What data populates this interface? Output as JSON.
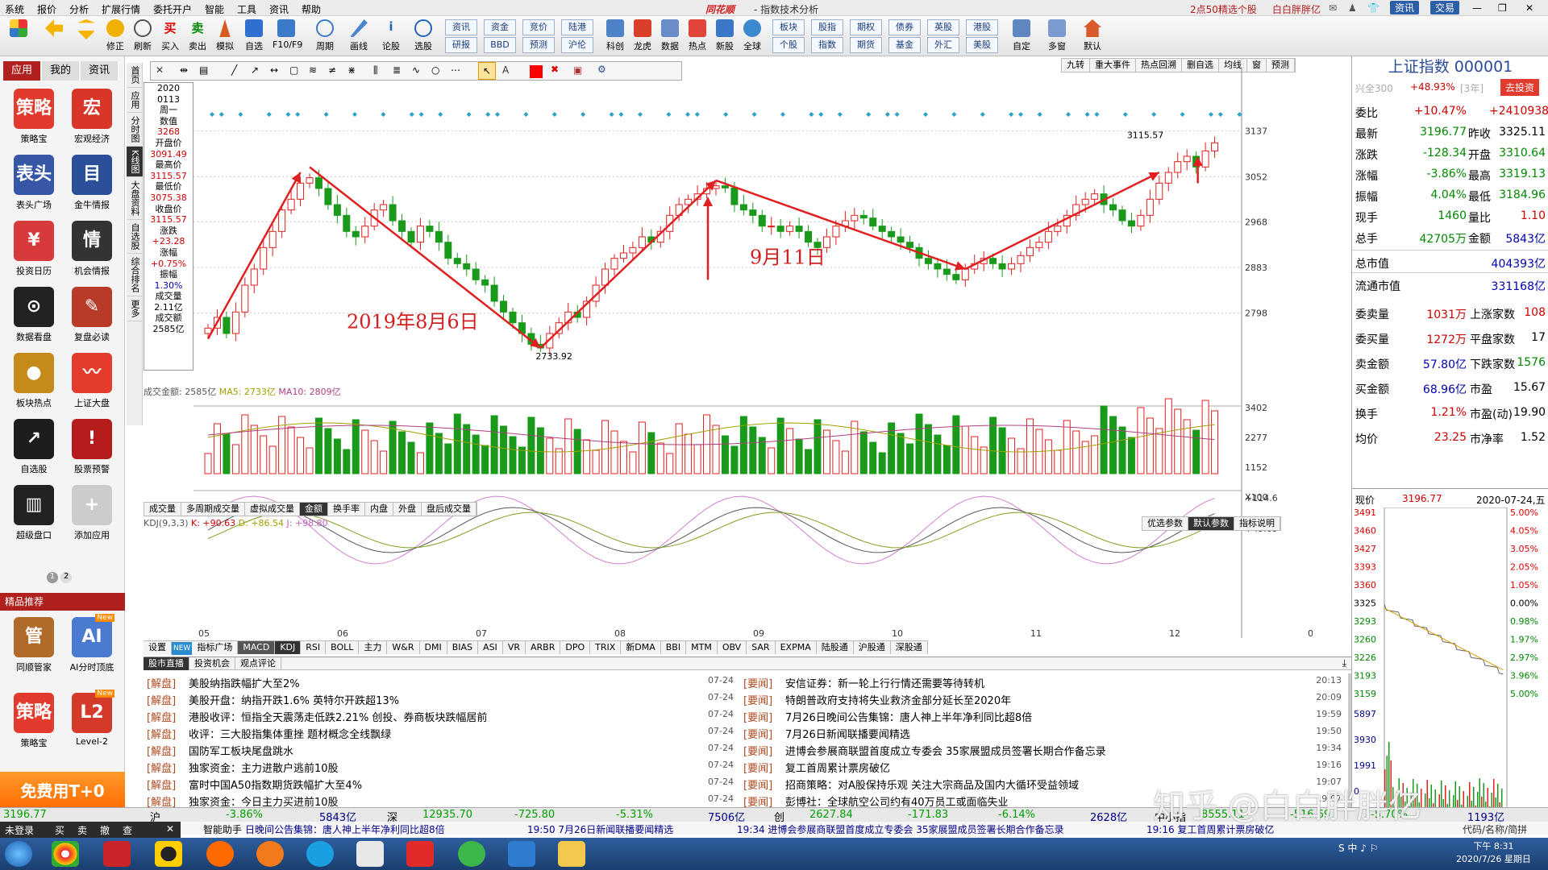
{
  "menubar": {
    "items": [
      "系统",
      "报价",
      "分析",
      "扩展行情",
      "委托开户",
      "智能",
      "工具",
      "资讯",
      "帮助"
    ],
    "app_name": "同花顺",
    "title": "- 指数技术分析",
    "promo": "2点50精选个股",
    "user": "白白胖胖亿"
  },
  "toolbar": {
    "buttons": [
      "修正",
      "刷新",
      "买入",
      "卖出",
      "模拟",
      "自选",
      "F10/F9",
      "周期",
      "画线",
      "论股",
      "选股"
    ],
    "buttons2": [
      "资讯",
      "资金",
      "竞价",
      "陆港"
    ],
    "buttons2_sub": [
      "研报",
      "BBD",
      "预测",
      "沪伦"
    ],
    "buttons3": [
      "科创",
      "龙虎",
      "数据",
      "热点",
      "新股",
      "全球"
    ],
    "buttons4": [
      "板块",
      "股指",
      "期权",
      "债券",
      "英股",
      "港股"
    ],
    "buttons4_sub": [
      "个股",
      "指数",
      "期货",
      "基金",
      "外汇",
      "美股"
    ],
    "buttons5": [
      "自定",
      "多窗",
      "默认"
    ]
  },
  "leftpanel": {
    "tabs": [
      "应用",
      "我的",
      "资讯"
    ],
    "apps": [
      {
        "label": "策略宝",
        "icon": "strategy-icon",
        "glyph": "策略",
        "color": "#e23b2e"
      },
      {
        "label": "宏观经济",
        "icon": "macro-icon",
        "glyph": "宏",
        "color": "#d9362a"
      },
      {
        "label": "表头广场",
        "icon": "header-icon",
        "glyph": "表头",
        "color": "#3557a6"
      },
      {
        "label": "金牛情报",
        "icon": "bull-icon",
        "glyph": "目",
        "color": "#2c4f9a"
      },
      {
        "label": "投资日历",
        "icon": "calendar-icon",
        "glyph": "¥",
        "color": "#d63a3a"
      },
      {
        "label": "机会情报",
        "icon": "opportunity-icon",
        "glyph": "情",
        "color": "#333333"
      },
      {
        "label": "数据看盘",
        "icon": "data-watch-icon",
        "glyph": "⊙",
        "color": "#222222"
      },
      {
        "label": "复盘必读",
        "icon": "review-icon",
        "glyph": "✎",
        "color": "#b83b2a"
      },
      {
        "label": "板块热点",
        "icon": "sector-hot-icon",
        "glyph": "●",
        "color": "#c58a1a"
      },
      {
        "label": "上证大盘",
        "icon": "sh-index-icon",
        "glyph": "〰",
        "color": "#e33c2c"
      },
      {
        "label": "自选股",
        "icon": "watchlist-icon",
        "glyph": "↗",
        "color": "#1d1d1d"
      },
      {
        "label": "股票预警",
        "icon": "alarm-icon",
        "glyph": "!",
        "color": "#b51c1c"
      },
      {
        "label": "超级盘口",
        "icon": "super-depth-icon",
        "glyph": "▥",
        "color": "#222222"
      },
      {
        "label": "添加应用",
        "icon": "add-app-icon",
        "glyph": "+",
        "color": "#cccccc"
      }
    ],
    "pager": [
      "1",
      "2"
    ],
    "featured_title": "精品推荐",
    "featured": [
      {
        "label": "同顺管家",
        "icon": "butler-icon",
        "glyph": "管",
        "color": "#b06a2a"
      },
      {
        "label": "AI分时顶底",
        "icon": "ai-chart-icon",
        "glyph": "AI",
        "color": "#4a7bd0",
        "badge": "New"
      },
      {
        "label": "策略宝",
        "icon": "strategy-icon",
        "glyph": "策略",
        "color": "#e23b2e"
      },
      {
        "label": "Level-2",
        "icon": "level2-icon",
        "glyph": "L2",
        "color": "#d33a2a",
        "badge": "New"
      }
    ],
    "free_banner": "免费用T+0"
  },
  "vtabs": [
    "首页",
    "应用",
    "分时图",
    "K线图",
    "大盘资料",
    "自选股",
    "综合排名",
    "更多"
  ],
  "drawbar_tabs": [
    "九转",
    "重大事件",
    "热点回溯",
    "删自选",
    "均线",
    "窗",
    "预测"
  ],
  "chart_data": [
    {
      "type": "candlestick",
      "title": "上证指数 K线",
      "xlabel": "",
      "ylabel": "",
      "y_ticks": [
        3137,
        3052,
        2968,
        2883,
        2798
      ],
      "x_ticks": [
        "05",
        "06",
        "07",
        "08",
        "09",
        "10",
        "11",
        "12",
        "01"
      ],
      "ylim": [
        2700,
        3150
      ],
      "ohlc_path": [
        2770,
        2790,
        2760,
        2800,
        2850,
        2880,
        2920,
        2950,
        2990,
        3010,
        3040,
        3050,
        3030,
        3000,
        2980,
        2950,
        2940,
        2960,
        2990,
        3000,
        2970,
        2950,
        2930,
        2960,
        2950,
        2930,
        2900,
        2890,
        2880,
        2860,
        2850,
        2820,
        2800,
        2780,
        2760,
        2740,
        2733,
        2760,
        2780,
        2800,
        2790,
        2820,
        2850,
        2880,
        2900,
        2910,
        2920,
        2940,
        2930,
        2950,
        2980,
        3000,
        3010,
        3020,
        3030,
        3035,
        3031,
        3000,
        2990,
        2980,
        2960,
        2960,
        2950,
        2960,
        2950,
        2930,
        2920,
        2940,
        2960,
        2970,
        2980,
        2975,
        2960,
        2950,
        2940,
        2930,
        2920,
        2900,
        2890,
        2880,
        2870,
        2860,
        2880,
        2890,
        2900,
        2890,
        2880,
        2890,
        2905,
        2920,
        2930,
        2950,
        2960,
        2980,
        3000,
        3010,
        3020,
        3000,
        2990,
        2970,
        2960,
        2980,
        3010,
        3040,
        3060,
        3080,
        3090,
        3070,
        3100,
        3115
      ],
      "annotations": [
        {
          "text": "2019年8月6日",
          "color": "#d22020"
        },
        {
          "text": "9月11日",
          "color": "#d22020"
        },
        {
          "text": "2733.92",
          "color": "#000000"
        },
        {
          "text": "3115.57",
          "color": "#000000"
        }
      ],
      "info_box": {
        "date_year": "2020",
        "date": "0113",
        "weekday": "周一",
        "value_label": "数值",
        "value": "3268",
        "open_label": "开盘价",
        "open": "3091.49",
        "high_label": "最高价",
        "high": "3115.57",
        "low_label": "最低价",
        "low": "3075.38",
        "close_label": "收盘价",
        "close": "3115.57",
        "change_label": "涨跌",
        "change": "+23.28",
        "pct_label": "涨幅",
        "pct": "+0.75%",
        "amp_label": "振幅",
        "amp": "1.30%",
        "vol_label": "成交量",
        "vol": "2.11亿",
        "amt_label": "成交额",
        "amt": "2585亿"
      }
    },
    {
      "type": "bar",
      "title": "成交金额: 2585亿",
      "ma5": "MA5: 2733亿",
      "ma10": "MA10: 2809亿",
      "y_ticks": [
        "3402",
        "2277",
        "1152",
        "X100"
      ],
      "tabs": [
        "成交量",
        "多周期成交量",
        "虚拟成交量",
        "金额",
        "换手率",
        "内盘",
        "外盘",
        "盘后成交量"
      ]
    },
    {
      "type": "line",
      "title": "KDJ(9,3,3)",
      "k": "K: +90.63",
      "d": "D: +86.54",
      "j": "J: +98.80",
      "y_ticks": [
        "+114.6",
        "+49.09"
      ],
      "param_tabs": [
        "优选参数",
        "默认参数",
        "指标说明"
      ]
    }
  ],
  "indicator_tabs": [
    "设置",
    "指标广场",
    "MACD",
    "KDJ",
    "RSI",
    "BOLL",
    "主力",
    "W&R",
    "DMI",
    "BIAS",
    "ASI",
    "VR",
    "ARBR",
    "DPO",
    "TRIX",
    "新DMA",
    "BBI",
    "MTM",
    "OBV",
    "SAR",
    "EXPMA",
    "陆股通",
    "沪股通",
    "深股通"
  ],
  "indicator_new_badge": "NEW",
  "right": {
    "title": "上证指数 000001",
    "compare_label": "兴全300",
    "compare_value": "+48.93%",
    "compare_period": "[3年]",
    "buy_button": "去投资",
    "rows": [
      {
        "l1": "委比",
        "v1": "+10.47%",
        "l2": "",
        "v2": "+2410938"
      },
      {
        "l1": "最新",
        "v1": "3196.77",
        "l2": "昨收",
        "v2": "3325.11"
      },
      {
        "l1": "涨跌",
        "v1": "-128.34",
        "l2": "开盘",
        "v2": "3310.64"
      },
      {
        "l1": "涨幅",
        "v1": "-3.86%",
        "l2": "最高",
        "v2": "3319.13"
      },
      {
        "l1": "振幅",
        "v1": "4.04%",
        "l2": "最低",
        "v2": "3184.96"
      },
      {
        "l1": "现手",
        "v1": "1460",
        "l2": "量比",
        "v2": "1.10"
      },
      {
        "l1": "总手",
        "v1": "42705万",
        "l2": "金额",
        "v2": "5843亿"
      }
    ],
    "rows2": [
      {
        "l": "总市值",
        "v": "404393亿"
      },
      {
        "l": "流通市值",
        "v": "331168亿"
      }
    ],
    "rows3": [
      {
        "l1": "委卖量",
        "v1": "1031万",
        "l2": "上涨家数",
        "v2": "108"
      },
      {
        "l1": "委买量",
        "v1": "1272万",
        "l2": "平盘家数",
        "v2": "17"
      },
      {
        "l1": "卖金额",
        "v1": "57.80亿",
        "l2": "下跌家数",
        "v2": "1576"
      },
      {
        "l1": "买金额",
        "v1": "68.96亿",
        "l2": "市盈",
        "v2": "15.67"
      },
      {
        "l1": "换手",
        "v1": "1.21%",
        "l2": "市盈(动)",
        "v2": "19.90"
      },
      {
        "l1": "均价",
        "v1": "23.25",
        "l2": "市净率",
        "v2": "1.52"
      }
    ],
    "now_label": "现价",
    "now_value": "3196.77",
    "now_date": "2020-07-24,五",
    "mini_left": [
      "3491",
      "3460",
      "3427",
      "3393",
      "3360",
      "3325",
      "3293",
      "3260",
      "3226",
      "3193",
      "3159",
      "5897",
      "3930",
      "1991",
      "0"
    ],
    "mini_right": [
      "5.00%",
      "4.05%",
      "3.05%",
      "2.05%",
      "1.05%",
      "0.00%",
      "0.98%",
      "1.97%",
      "2.97%",
      "3.96%",
      "5.00%"
    ]
  },
  "news": {
    "tabs": [
      "股市直播",
      "投资机会",
      "观点评论"
    ],
    "left": [
      {
        "tag": "[解盘]",
        "text": "美股纳指跌幅扩大至2%",
        "time": "07-24"
      },
      {
        "tag": "[解盘]",
        "text": "美股开盘：纳指开跌1.6% 英特尔开跌超13%",
        "time": "07-24"
      },
      {
        "tag": "[解盘]",
        "text": "港股收评：恒指全天震荡走低跌2.21% 创投、券商板块跌幅居前",
        "time": "07-24"
      },
      {
        "tag": "[解盘]",
        "text": "收评：三大股指集体重挫 题材概念全线飘绿",
        "time": "07-24"
      },
      {
        "tag": "[解盘]",
        "text": "国防军工板块尾盘跳水",
        "time": "07-24"
      },
      {
        "tag": "[解盘]",
        "text": "独家资金：主力进散户逃前10股",
        "time": "07-24"
      },
      {
        "tag": "[解盘]",
        "text": "富时中国A50指数期货跌幅扩大至4%",
        "time": "07-24"
      },
      {
        "tag": "[解盘]",
        "text": "独家资金：今日主力买进前10股",
        "time": "07-24"
      }
    ],
    "right": [
      {
        "tag": "[要闻]",
        "text": "安信证券：新一轮上行行情还需要等待转机",
        "time": "20:13"
      },
      {
        "tag": "[要闻]",
        "text": "特朗普政府支持将失业救济金部分延长至2020年",
        "time": "20:09"
      },
      {
        "tag": "[要闻]",
        "text": "7月26日晚间公告集锦：唐人神上半年净利同比超8倍",
        "time": "19:59"
      },
      {
        "tag": "[要闻]",
        "text": "7月26日新闻联播要闻精选",
        "time": "19:50"
      },
      {
        "tag": "[要闻]",
        "text": "进博会参展商联盟首度成立专委会 35家展盟成员签署长期合作备忘录",
        "time": "19:34"
      },
      {
        "tag": "[要闻]",
        "text": "复工首周累计票房破亿",
        "time": "19:16"
      },
      {
        "tag": "[要闻]",
        "text": "招商策略：对A股保持乐观 关注大宗商品及国内大循环受益领域",
        "time": "19:07"
      },
      {
        "tag": "[要闻]",
        "text": "彭博社：全球航空公司约有40万员工或面临失业",
        "time": "19:07"
      }
    ]
  },
  "statusbar": {
    "items": [
      "沪",
      "-3.86%",
      "5843亿",
      "深",
      "12935.70",
      "-725.80",
      "-5.31%",
      "7506亿",
      "创",
      "2627.84",
      "-171.83",
      "-6.14%",
      "2628亿",
      "中小指",
      "8555.11",
      "-516.69",
      "-5.70%",
      "1193亿"
    ],
    "first_value": "3196.77",
    "mid_value": "-128.34"
  },
  "tickerbar": {
    "login": "未登录",
    "actions": [
      "买",
      "卖",
      "撤",
      "查"
    ],
    "assistant": "智能助手",
    "items": [
      "日晚间公告集锦：唐人神上半年净利同比超8倍",
      "19:50 7月26日新闻联播要闻精选",
      "19:34 进博会参展商联盟首度成立专委会 35家展盟成员签署长期合作备忘录",
      "19:16 复工首周累计票房破亿"
    ],
    "right": "代码/名称/简拼"
  },
  "taskbar": {
    "time": "下午 8:31",
    "date": "2020/7/26 星期日"
  },
  "watermark": "知乎 @白白胖胖亿"
}
